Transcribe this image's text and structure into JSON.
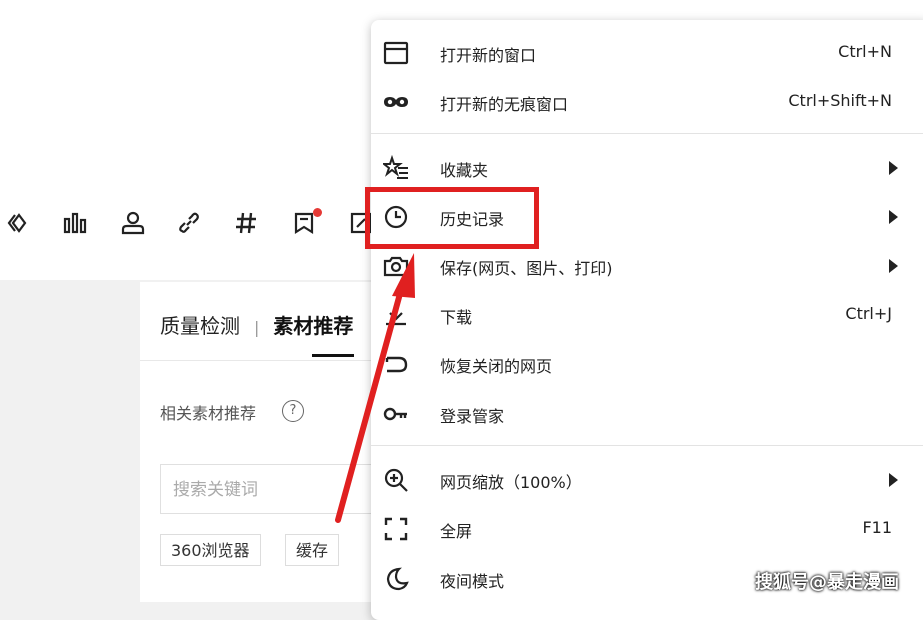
{
  "panel": {
    "tabs": [
      "质量检测",
      "素材推荐"
    ],
    "separator": "|",
    "rec_title": "相关素材推荐",
    "help_symbol": "?",
    "search_placeholder": "搜索关键词",
    "chips": [
      "360浏览器",
      "缓存"
    ]
  },
  "toolbar_icons": [
    "code-icon",
    "bar-chart-icon",
    "person-icon",
    "link-icon",
    "hash-icon",
    "bookmark-icon",
    "edit-icon"
  ],
  "menu": {
    "items": [
      {
        "label": "打开新的窗口",
        "shortcut": "Ctrl+N",
        "icon": "window-icon",
        "submenu": false
      },
      {
        "label": "打开新的无痕窗口",
        "shortcut": "Ctrl+Shift+N",
        "icon": "incognito-icon",
        "submenu": false
      },
      {
        "label": "收藏夹",
        "shortcut": "",
        "icon": "favorites-star-icon",
        "submenu": true
      },
      {
        "label": "历史记录",
        "shortcut": "",
        "icon": "clock-icon",
        "submenu": true
      },
      {
        "label": "保存(网页、图片、打印)",
        "shortcut": "",
        "icon": "camera-icon",
        "submenu": true
      },
      {
        "label": "下载",
        "shortcut": "Ctrl+J",
        "icon": "download-icon",
        "submenu": false
      },
      {
        "label": "恢复关闭的网页",
        "shortcut": "",
        "icon": "restore-icon",
        "submenu": false
      },
      {
        "label": "登录管家",
        "shortcut": "",
        "icon": "key-icon",
        "submenu": false
      },
      {
        "label": "网页缩放（100%）",
        "shortcut": "",
        "icon": "zoom-icon",
        "submenu": true
      },
      {
        "label": "全屏",
        "shortcut": "F11",
        "icon": "fullscreen-icon",
        "submenu": false
      },
      {
        "label": "夜间模式",
        "shortcut": "",
        "icon": "moon-icon",
        "submenu": false
      }
    ]
  },
  "watermark": "搜狐号@暴走漫画",
  "colors": {
    "highlight": "#e02020",
    "accent_dot": "#e53935"
  }
}
